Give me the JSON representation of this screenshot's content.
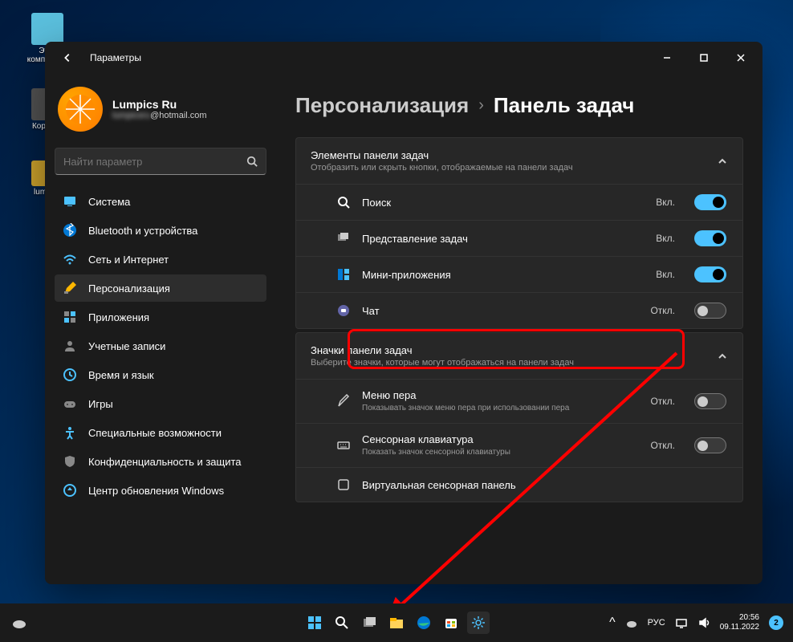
{
  "desktop": {
    "icons": [
      {
        "label": "Этот\nкомпьютер"
      },
      {
        "label": "Корзина"
      },
      {
        "label": "lumpics"
      }
    ]
  },
  "window": {
    "title": "Параметры"
  },
  "profile": {
    "name": "Lumpics Ru",
    "email": "@hotmail.com"
  },
  "search": {
    "placeholder": "Найти параметр"
  },
  "nav": [
    {
      "label": "Система",
      "icon": "system"
    },
    {
      "label": "Bluetooth и устройства",
      "icon": "bluetooth"
    },
    {
      "label": "Сеть и Интернет",
      "icon": "wifi"
    },
    {
      "label": "Персонализация",
      "icon": "brush",
      "active": true
    },
    {
      "label": "Приложения",
      "icon": "apps"
    },
    {
      "label": "Учетные записи",
      "icon": "account"
    },
    {
      "label": "Время и язык",
      "icon": "time"
    },
    {
      "label": "Игры",
      "icon": "games"
    },
    {
      "label": "Специальные возможности",
      "icon": "access"
    },
    {
      "label": "Конфиденциальность и защита",
      "icon": "shield"
    },
    {
      "label": "Центр обновления Windows",
      "icon": "update"
    }
  ],
  "breadcrumb": {
    "parent": "Персонализация",
    "current": "Панель задач"
  },
  "sections": [
    {
      "title": "Элементы панели задач",
      "desc": "Отобразить или скрыть кнопки, отображаемые на панели задач",
      "items": [
        {
          "label": "Поиск",
          "icon": "search",
          "state": "Вкл.",
          "on": true
        },
        {
          "label": "Представление задач",
          "icon": "taskview",
          "state": "Вкл.",
          "on": true
        },
        {
          "label": "Мини-приложения",
          "icon": "widgets",
          "state": "Вкл.",
          "on": true
        },
        {
          "label": "Чат",
          "icon": "chat",
          "state": "Откл.",
          "on": false,
          "highlight": true
        }
      ]
    },
    {
      "title": "Значки панели задач",
      "desc": "Выберите значки, которые могут отображаться на панели задач",
      "items": [
        {
          "label": "Меню пера",
          "desc": "Показывать значок меню пера при использовании пера",
          "icon": "pen",
          "state": "Откл.",
          "on": false
        },
        {
          "label": "Сенсорная клавиатура",
          "desc": "Показать значок сенсорной клавиатуры",
          "icon": "keyboard",
          "state": "Откл.",
          "on": false
        },
        {
          "label": "Виртуальная сенсорная панель",
          "icon": "touchpad"
        }
      ]
    }
  ],
  "taskbar": {
    "lang": "РУС",
    "time": "20:56",
    "date": "09.11.2022",
    "notif_count": "2"
  }
}
